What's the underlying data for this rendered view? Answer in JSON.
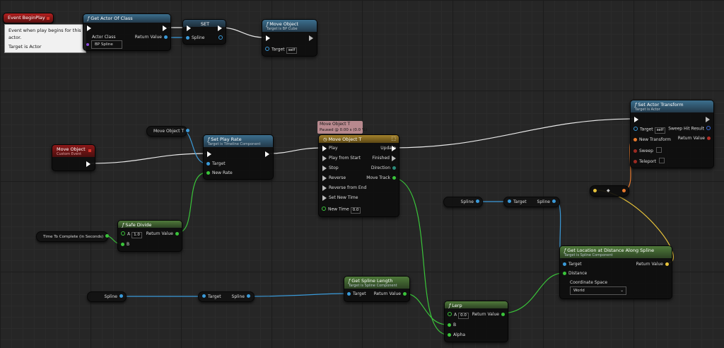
{
  "tooltip": {
    "line1": "Event when play begins for this actor.",
    "line2": "Target is Actor"
  },
  "event_beginplay": {
    "title": "Event BeginPlay"
  },
  "get_actor": {
    "title": "Get Actor Of Class",
    "actor_class": "Actor Class",
    "class_value": "BP Spline",
    "return_value": "Return Value"
  },
  "set_node": {
    "title": "SET",
    "spline": "Spline"
  },
  "move_object_call": {
    "title": "Move Object",
    "subtitle": "Target is BP Cube",
    "target": "Target",
    "target_value": "self"
  },
  "move_object_t_var": {
    "label": "Move Object T"
  },
  "set_play_rate": {
    "title": "Set Play Rate",
    "subtitle": "Target is Timeline Component",
    "target": "Target",
    "new_rate": "New Rate"
  },
  "custom_event": {
    "title": "Move Object",
    "subtitle": "Custom Event"
  },
  "timeline_comment": {
    "line1": "Move Object T",
    "line2": "Paused @ 0.00 s (0.0 %)"
  },
  "timeline": {
    "title": "Move Object T",
    "inputs": [
      "Play",
      "Play from Start",
      "Stop",
      "Reverse",
      "Reverse from End",
      "Set New Time"
    ],
    "new_time": "New Time",
    "new_time_value": "0.0",
    "outputs": [
      "Update",
      "Finished",
      "Direction",
      "Move Track"
    ]
  },
  "set_actor_transform": {
    "title": "Set Actor Transform",
    "subtitle": "Target is Actor",
    "target": "Target",
    "target_value": "self",
    "new_transform": "New Transform",
    "sweep": "Sweep",
    "teleport": "Teleport",
    "sweep_hit": "Sweep Hit Result",
    "return_value": "Return Value"
  },
  "safe_divide": {
    "title": "Safe Divide",
    "a": "A",
    "a_value": "1.0",
    "b": "B",
    "return_value": "Return Value"
  },
  "time_var": {
    "label": "Time To Complete (in Seconds)"
  },
  "spline_var_1": {
    "label": "Spline"
  },
  "spline_get_1": {
    "target": "Target",
    "spline": "Spline"
  },
  "spline_var_2": {
    "label": "Spline"
  },
  "spline_get_2": {
    "target": "Target",
    "spline": "Spline"
  },
  "make_transform": {
    "symbol": "◆"
  },
  "get_location": {
    "title": "Get Location at Distance Along Spline",
    "subtitle": "Target is Spline Component",
    "target": "Target",
    "distance": "Distance",
    "coord_space": "Coordinate Space",
    "coord_value": "World",
    "return_value": "Return Value"
  },
  "get_spline_length": {
    "title": "Get Spline Length",
    "subtitle": "Target is Spline Component",
    "target": "Target",
    "return_value": "Return Value"
  },
  "lerp": {
    "title": "Lerp",
    "a": "A",
    "a_value": "0.0",
    "b": "B",
    "alpha": "Alpha",
    "return_value": "Return Value"
  },
  "colors": {
    "exec": "#ffffff",
    "object": "#3a9ad9",
    "float": "#3ac43a",
    "transform": "#e8792d",
    "vector": "#e8c33a"
  }
}
